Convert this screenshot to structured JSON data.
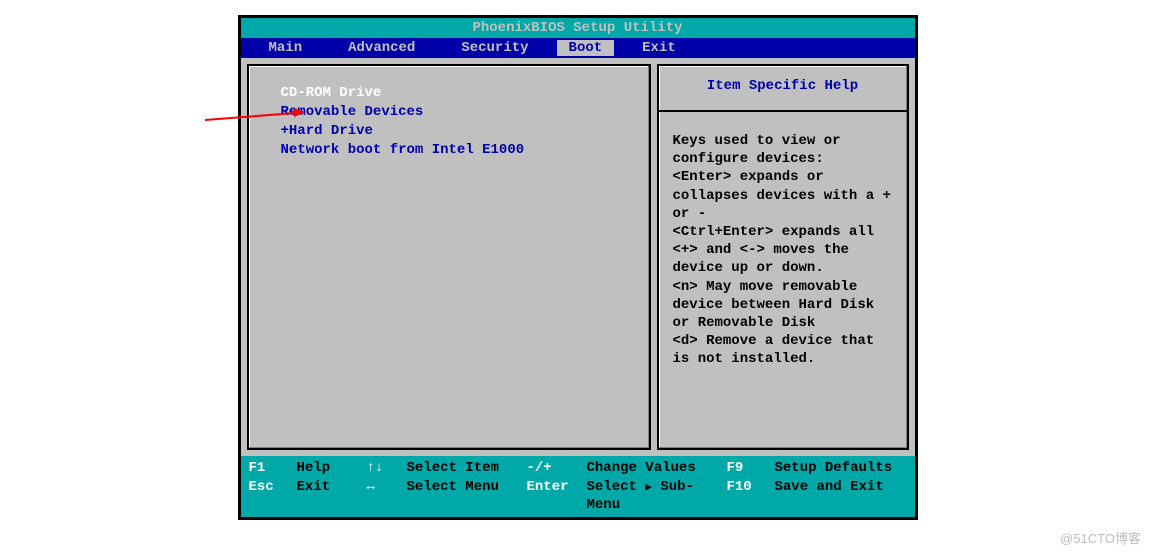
{
  "title": "PhoenixBIOS Setup Utility",
  "menu": {
    "items": [
      "Main",
      "Advanced",
      "Security",
      "Boot",
      "Exit"
    ],
    "selected_index": 3
  },
  "boot_items": [
    {
      "label": "CD-ROM Drive",
      "selected": true,
      "prefix": " "
    },
    {
      "label": "Removable Devices",
      "selected": false,
      "prefix": " "
    },
    {
      "label": "Hard Drive",
      "selected": false,
      "prefix": "+"
    },
    {
      "label": "Network boot from Intel E1000",
      "selected": false,
      "prefix": " "
    }
  ],
  "help": {
    "title": "Item Specific Help",
    "text": "Keys used to view or configure devices:\n<Enter> expands or collapses devices with a + or -\n<Ctrl+Enter> expands all\n<+> and <-> moves the device up or down.\n<n> May move removable device between Hard Disk or Removable Disk\n<d> Remove a device that is not installed."
  },
  "footer": {
    "rows": [
      {
        "key": "F1",
        "label": "Help",
        "arrows": "↑↓",
        "action": "Select Item",
        "key2": "-/+",
        "label2": "Change Values",
        "key3": "F9",
        "label3": "Setup Defaults"
      },
      {
        "key": "Esc",
        "label": "Exit",
        "arrows": "↔",
        "action": "Select Menu",
        "key2": "Enter",
        "label2": "Select ▸ Sub-Menu",
        "key3": "F10",
        "label3": "Save and Exit"
      }
    ]
  },
  "watermark": "@51CTO博客"
}
